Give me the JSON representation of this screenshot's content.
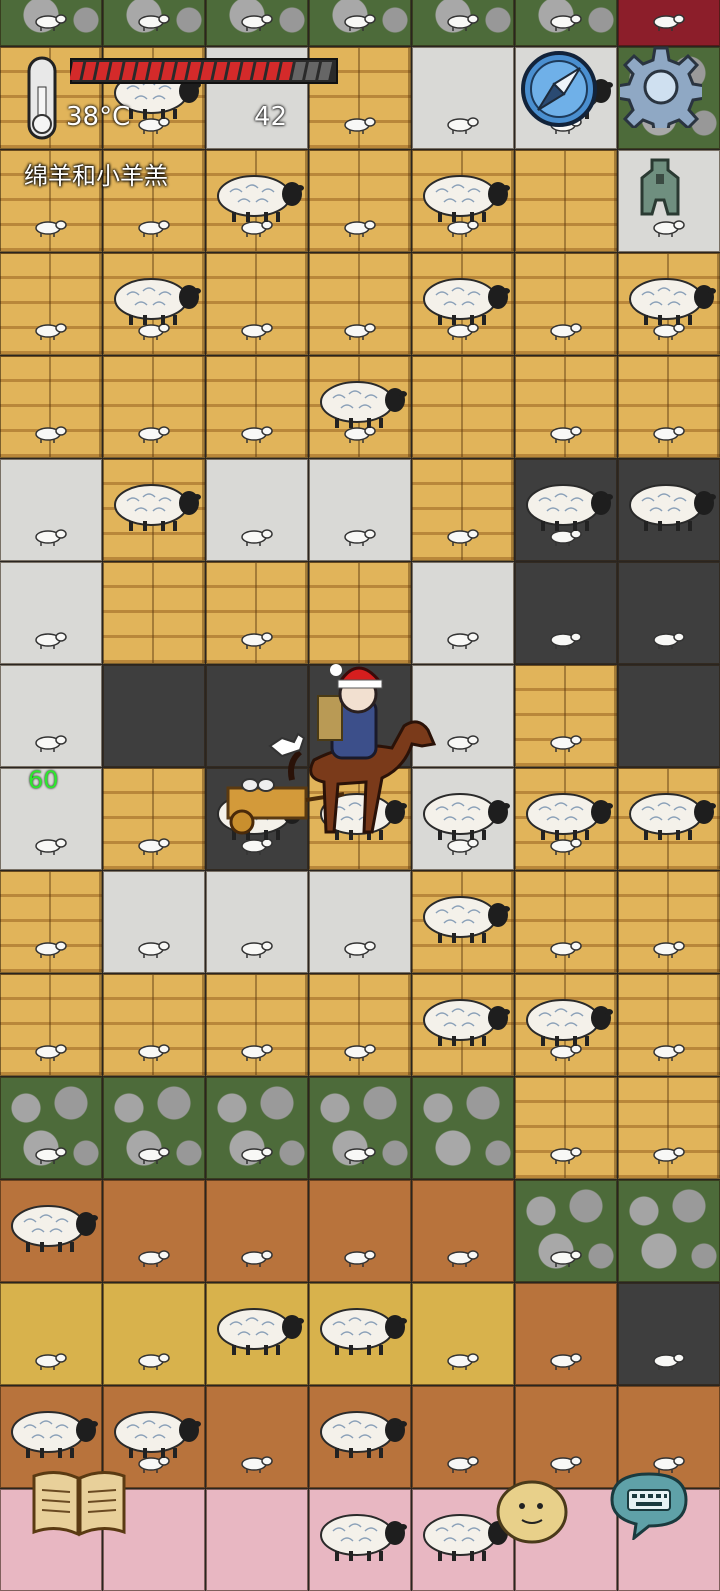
{
  "hud": {
    "temperature": "38°C",
    "yum_counter": "42",
    "biome_label": "绵羊和小羊羔",
    "age": "60",
    "food_level": 0.85,
    "food_segments": 20,
    "thermometer_level": 0.75
  },
  "icons": {
    "thermometer": "thermometer-icon",
    "food_bar": "hunger-bar",
    "compass": "compass-icon",
    "settings": "gear-icon",
    "coin": "spade-coin-icon",
    "tech_book": "book-icon",
    "emote": "emote-face-icon",
    "chat": "keyboard-icon"
  },
  "colors": {
    "food_fill": "#d42a2a",
    "age_text": "#2ee82e",
    "compass_face": "#4a8fd0",
    "chat_bubble": "#5fa1a8"
  },
  "map": {
    "rows": [
      "SSSSSSR",
      "PPXPXXS",
      "PPPPPPX",
      "PPPPPPP",
      "PPPPPPP",
      "XPXXPDD",
      "XPPPXDD",
      "XDDDXPD",
      "XPDPXPP",
      "PXXXPPP",
      "PPPPPPP",
      "SSSSSPP",
      "CCCCCSS",
      "HHHHHCD",
      "CCCCCCC",
      "KKKKKKK"
    ],
    "sheep": [
      [
        1,
        1
      ],
      [
        5,
        1
      ],
      [
        2,
        2
      ],
      [
        4,
        2
      ],
      [
        1,
        3
      ],
      [
        4,
        3
      ],
      [
        3,
        4
      ],
      [
        5,
        5
      ],
      [
        6,
        5
      ],
      [
        1,
        5
      ],
      [
        3,
        8
      ],
      [
        2,
        8
      ],
      [
        4,
        8
      ],
      [
        5,
        8
      ],
      [
        6,
        8
      ],
      [
        4,
        9
      ],
      [
        4,
        10
      ],
      [
        5,
        10
      ],
      [
        0,
        12
      ],
      [
        2,
        13
      ],
      [
        3,
        13
      ],
      [
        0,
        14
      ],
      [
        1,
        14
      ],
      [
        3,
        14
      ],
      [
        3,
        15
      ],
      [
        4,
        15
      ],
      [
        6,
        3
      ]
    ],
    "lambs": [
      [
        0,
        0
      ],
      [
        1,
        0
      ],
      [
        2,
        0
      ],
      [
        3,
        0
      ],
      [
        4,
        0
      ],
      [
        5,
        0
      ],
      [
        6,
        0
      ],
      [
        1,
        1
      ],
      [
        3,
        1
      ],
      [
        4,
        1
      ],
      [
        5,
        1
      ],
      [
        0,
        2
      ],
      [
        1,
        2
      ],
      [
        2,
        2
      ],
      [
        3,
        2
      ],
      [
        4,
        2
      ],
      [
        6,
        2
      ],
      [
        0,
        3
      ],
      [
        1,
        3
      ],
      [
        2,
        3
      ],
      [
        3,
        3
      ],
      [
        4,
        3
      ],
      [
        5,
        3
      ],
      [
        6,
        3
      ],
      [
        0,
        4
      ],
      [
        1,
        4
      ],
      [
        2,
        4
      ],
      [
        3,
        4
      ],
      [
        5,
        4
      ],
      [
        6,
        4
      ],
      [
        0,
        5
      ],
      [
        2,
        5
      ],
      [
        3,
        5
      ],
      [
        4,
        5
      ],
      [
        5,
        5
      ],
      [
        0,
        6
      ],
      [
        2,
        6
      ],
      [
        4,
        6
      ],
      [
        5,
        6
      ],
      [
        6,
        6
      ],
      [
        0,
        7
      ],
      [
        3,
        7
      ],
      [
        4,
        7
      ],
      [
        5,
        7
      ],
      [
        0,
        8
      ],
      [
        1,
        8
      ],
      [
        2,
        8
      ],
      [
        4,
        8
      ],
      [
        5,
        8
      ],
      [
        0,
        9
      ],
      [
        1,
        9
      ],
      [
        2,
        9
      ],
      [
        3,
        9
      ],
      [
        5,
        9
      ],
      [
        6,
        9
      ],
      [
        0,
        10
      ],
      [
        1,
        10
      ],
      [
        2,
        10
      ],
      [
        3,
        10
      ],
      [
        5,
        10
      ],
      [
        6,
        10
      ],
      [
        0,
        11
      ],
      [
        1,
        11
      ],
      [
        2,
        11
      ],
      [
        3,
        11
      ],
      [
        5,
        11
      ],
      [
        6,
        11
      ],
      [
        1,
        12
      ],
      [
        2,
        12
      ],
      [
        3,
        12
      ],
      [
        4,
        12
      ],
      [
        5,
        12
      ],
      [
        0,
        13
      ],
      [
        1,
        13
      ],
      [
        4,
        13
      ],
      [
        5,
        13
      ],
      [
        6,
        13
      ],
      [
        1,
        14
      ],
      [
        2,
        14
      ],
      [
        4,
        14
      ],
      [
        5,
        14
      ],
      [
        6,
        14
      ]
    ]
  }
}
